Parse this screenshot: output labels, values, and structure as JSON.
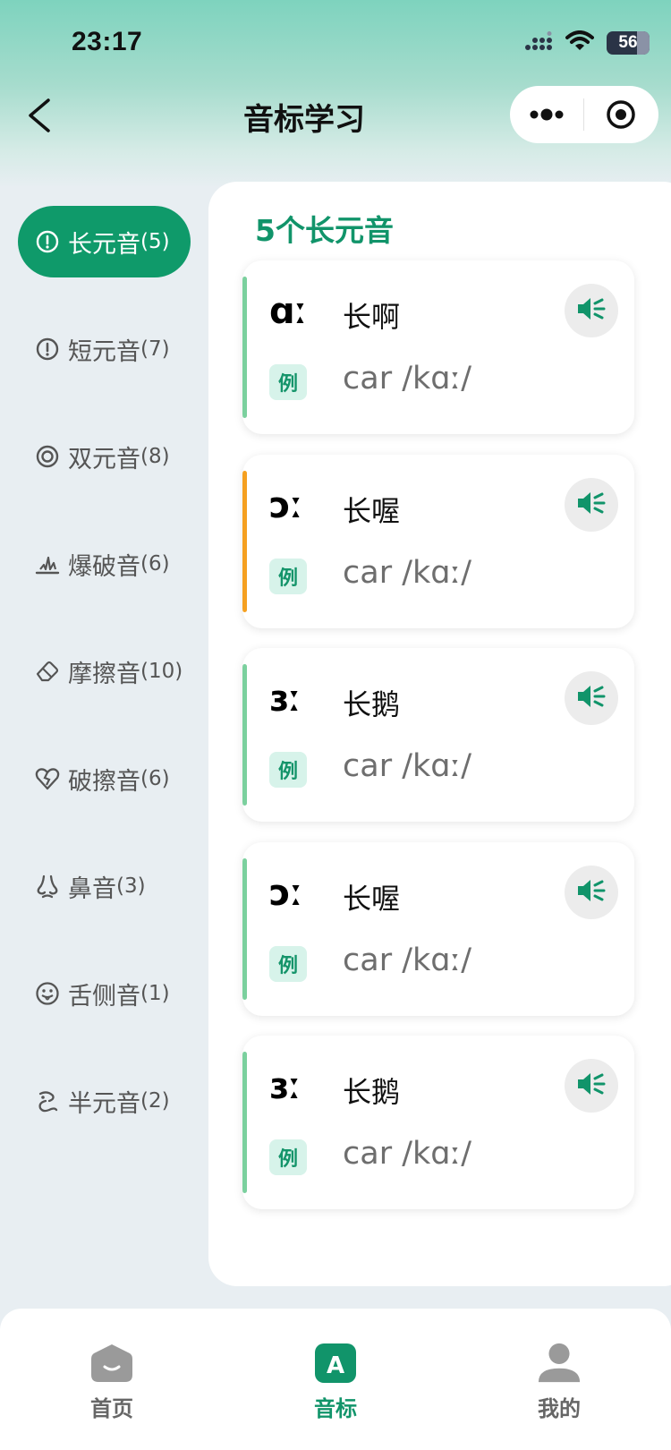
{
  "status_bar": {
    "time": "23:17",
    "battery": "56"
  },
  "nav": {
    "title": "音标学习"
  },
  "sidebar": {
    "items": [
      {
        "label": "长元音",
        "count": "(5)",
        "icon": "info-circle-icon",
        "active": true
      },
      {
        "label": "短元音",
        "count": "(7)",
        "icon": "info-circle-icon",
        "active": false
      },
      {
        "label": "双元音",
        "count": "(8)",
        "icon": "double-ring-icon",
        "active": false
      },
      {
        "label": "爆破音",
        "count": "(6)",
        "icon": "explosion-icon",
        "active": false
      },
      {
        "label": "摩擦音",
        "count": "(10)",
        "icon": "eraser-icon",
        "active": false
      },
      {
        "label": "破擦音",
        "count": "(6)",
        "icon": "broken-heart-icon",
        "active": false
      },
      {
        "label": "鼻音",
        "count": "(3)",
        "icon": "nose-icon",
        "active": false
      },
      {
        "label": "舌侧音",
        "count": "(1)",
        "icon": "tongue-face-icon",
        "active": false
      },
      {
        "label": "半元音",
        "count": "(2)",
        "icon": "half-vowel-icon",
        "active": false
      }
    ]
  },
  "main": {
    "section_title": "5个长元音",
    "example_tag": "例",
    "cards": [
      {
        "symbol": "ɑː",
        "name": "长啊",
        "example": "car /kɑː/",
        "accent": "#7bd09e"
      },
      {
        "symbol": "ɔː",
        "name": "长喔",
        "example": "car /kɑː/",
        "accent": "#f5a020"
      },
      {
        "symbol": "ɜː",
        "name": "长鹅",
        "example": "car /kɑː/",
        "accent": "#7bd09e"
      },
      {
        "symbol": "ɔː",
        "name": "长喔",
        "example": "car /kɑː/",
        "accent": "#7bd09e"
      },
      {
        "symbol": "ɜː",
        "name": "长鹅",
        "example": "car /kɑː/",
        "accent": "#7bd09e"
      }
    ]
  },
  "tab_bar": {
    "tabs": [
      {
        "label": "首页",
        "icon": "home-icon"
      },
      {
        "label": "音标",
        "icon": "phonetic-a-icon"
      },
      {
        "label": "我的",
        "icon": "user-icon"
      }
    ]
  },
  "colors": {
    "brand": "#0f9a6a",
    "accent_orange": "#f5a020",
    "accent_green": "#7bd09e"
  }
}
